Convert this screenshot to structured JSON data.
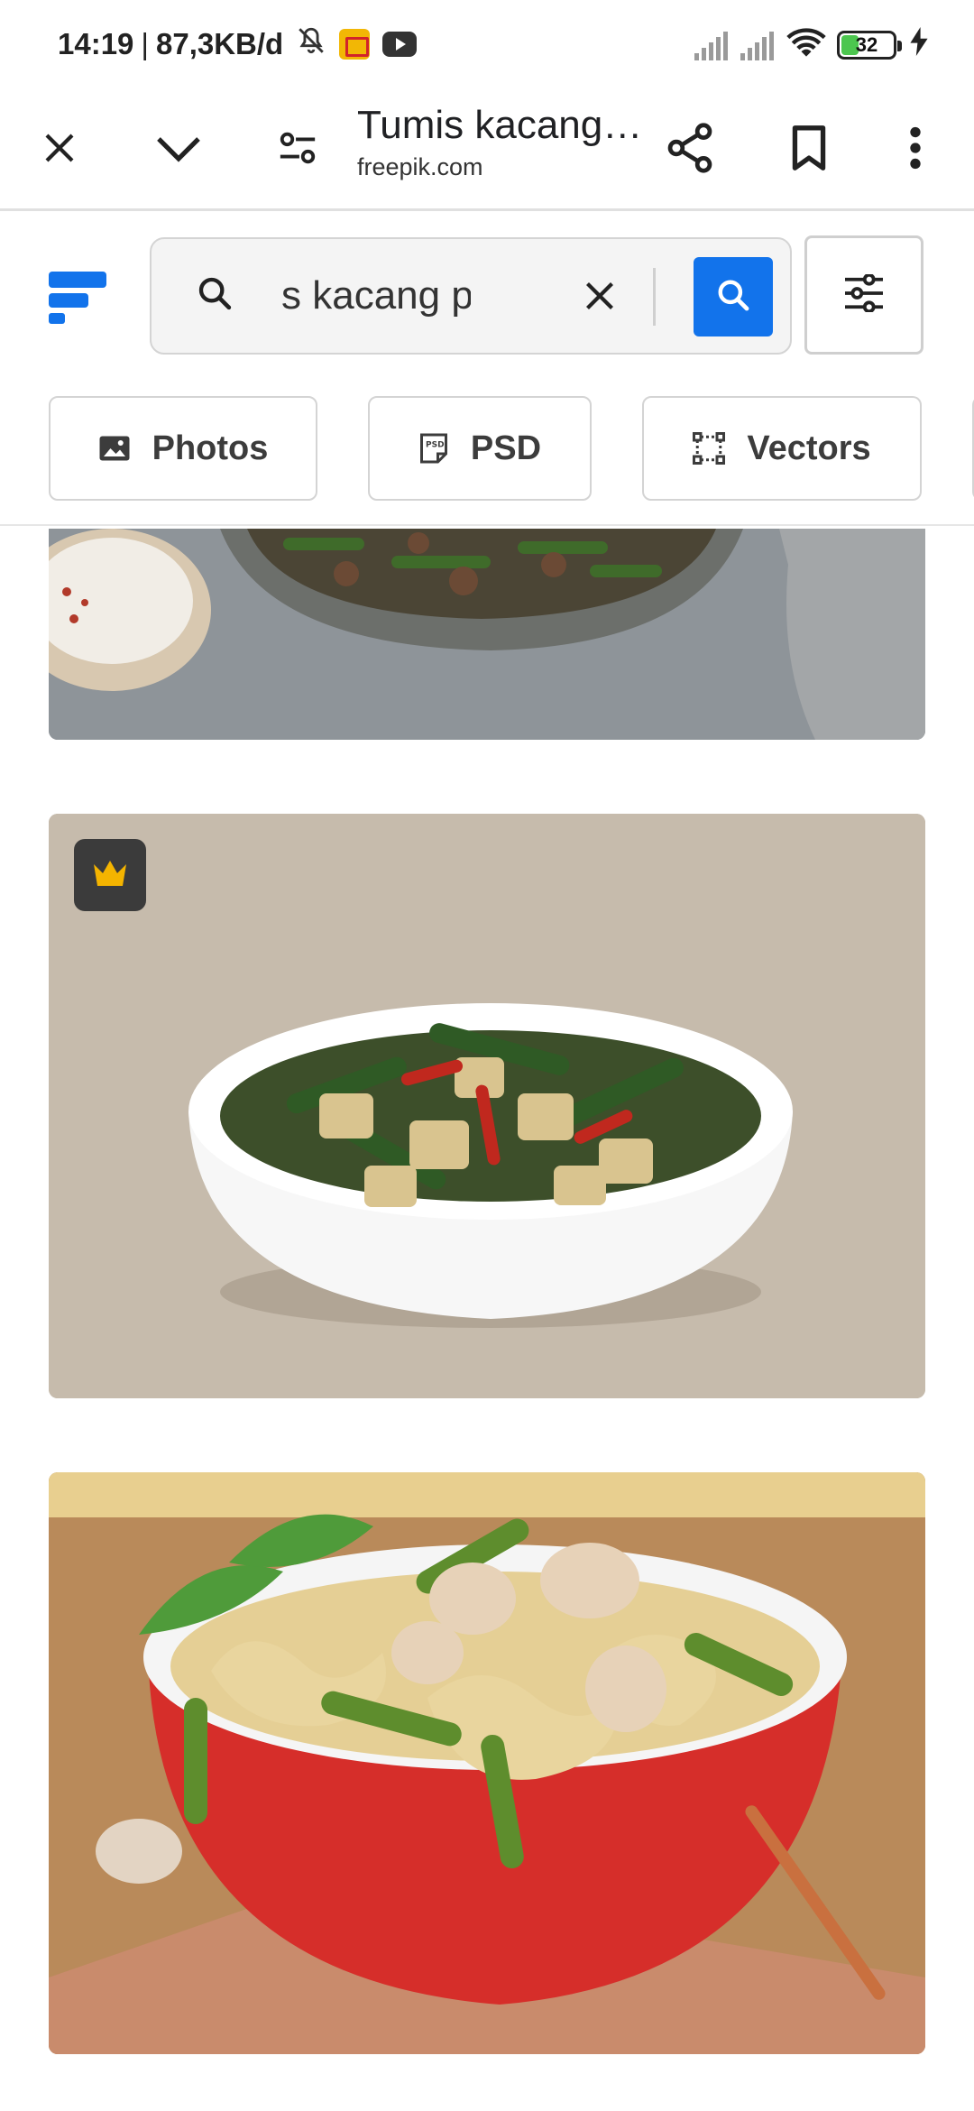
{
  "status_bar": {
    "time": "14:19",
    "separator": "|",
    "net_speed": "87,3KB/d",
    "battery_level": "32",
    "battery_fraction": 0.32
  },
  "browser": {
    "page_title": "Tumis kacang…",
    "url": "freepik.com",
    "icons": [
      "close-icon",
      "chevron-down-icon",
      "site-settings-icon",
      "share-icon",
      "bookmark-icon",
      "more-vert-icon"
    ]
  },
  "freepik": {
    "search": {
      "value": "s kacang pa"
    },
    "chips": [
      {
        "label": "Photos",
        "icon": "image-icon"
      },
      {
        "label": "PSD",
        "icon": "psd-file-icon"
      },
      {
        "label": "Vectors",
        "icon": "vector-icon"
      }
    ],
    "colors": {
      "brand_blue": "#1273eb",
      "premium_crown": "#f4b400"
    }
  },
  "results": [
    {
      "description_icon": "food-photo",
      "premium": false
    },
    {
      "description_icon": "food-photo",
      "premium": true
    },
    {
      "description_icon": "food-photo",
      "premium": false
    }
  ]
}
